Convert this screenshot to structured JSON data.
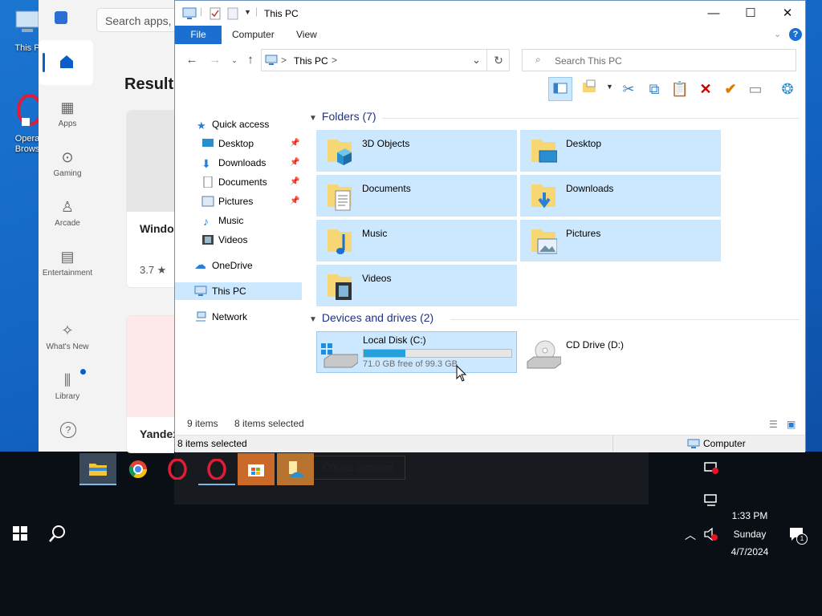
{
  "desktop": {
    "icons": [
      {
        "label": "This P"
      },
      {
        "label": "Opera Brows"
      }
    ]
  },
  "store": {
    "search_placeholder": "Search apps, g",
    "results_heading": "Results",
    "nav": [
      {
        "label": "Apps"
      },
      {
        "label": "Gaming"
      },
      {
        "label": "Arcade"
      },
      {
        "label": "Entertainment"
      },
      {
        "label": "What's New"
      },
      {
        "label": "Library"
      }
    ],
    "cards": [
      {
        "title": "Windo",
        "rating": "3.7 ★"
      },
      {
        "title": "Yandex"
      }
    ],
    "create_account": "Create account"
  },
  "explorer": {
    "title": "This PC",
    "tabs": [
      "File",
      "Computer",
      "View"
    ],
    "help": "?",
    "address": {
      "location": "This PC",
      "separator": ">"
    },
    "search_placeholder": "Search This PC",
    "nav_pane": {
      "quick_access": "Quick access",
      "pinned": [
        {
          "label": "Desktop"
        },
        {
          "label": "Downloads"
        },
        {
          "label": "Documents"
        },
        {
          "label": "Pictures"
        }
      ],
      "unpinned": [
        {
          "label": "Music"
        },
        {
          "label": "Videos"
        }
      ],
      "onedrive": "OneDrive",
      "this_pc": "This PC",
      "network": "Network"
    },
    "folders_header": "Folders (7)",
    "folders": [
      "3D Objects",
      "Desktop",
      "Documents",
      "Downloads",
      "Music",
      "Pictures",
      "Videos"
    ],
    "drives_header": "Devices and drives (2)",
    "drives": [
      {
        "name": "Local Disk (C:)",
        "free": "71.0 GB free of 99.3 GB",
        "used_fraction": 0.285
      },
      {
        "name": "CD Drive (D:)"
      }
    ],
    "item_count": "9 items",
    "selected_count": "8 items selected",
    "status_left": "8 items selected",
    "status_right": "Computer"
  },
  "taskbar": {
    "time": "1:33 PM",
    "day": "Sunday",
    "date": "4/7/2024",
    "notification_count": "1"
  },
  "colors": {
    "accent": "#1a6fd0",
    "selection": "#cce8ff",
    "desktop": "#1363c2"
  }
}
